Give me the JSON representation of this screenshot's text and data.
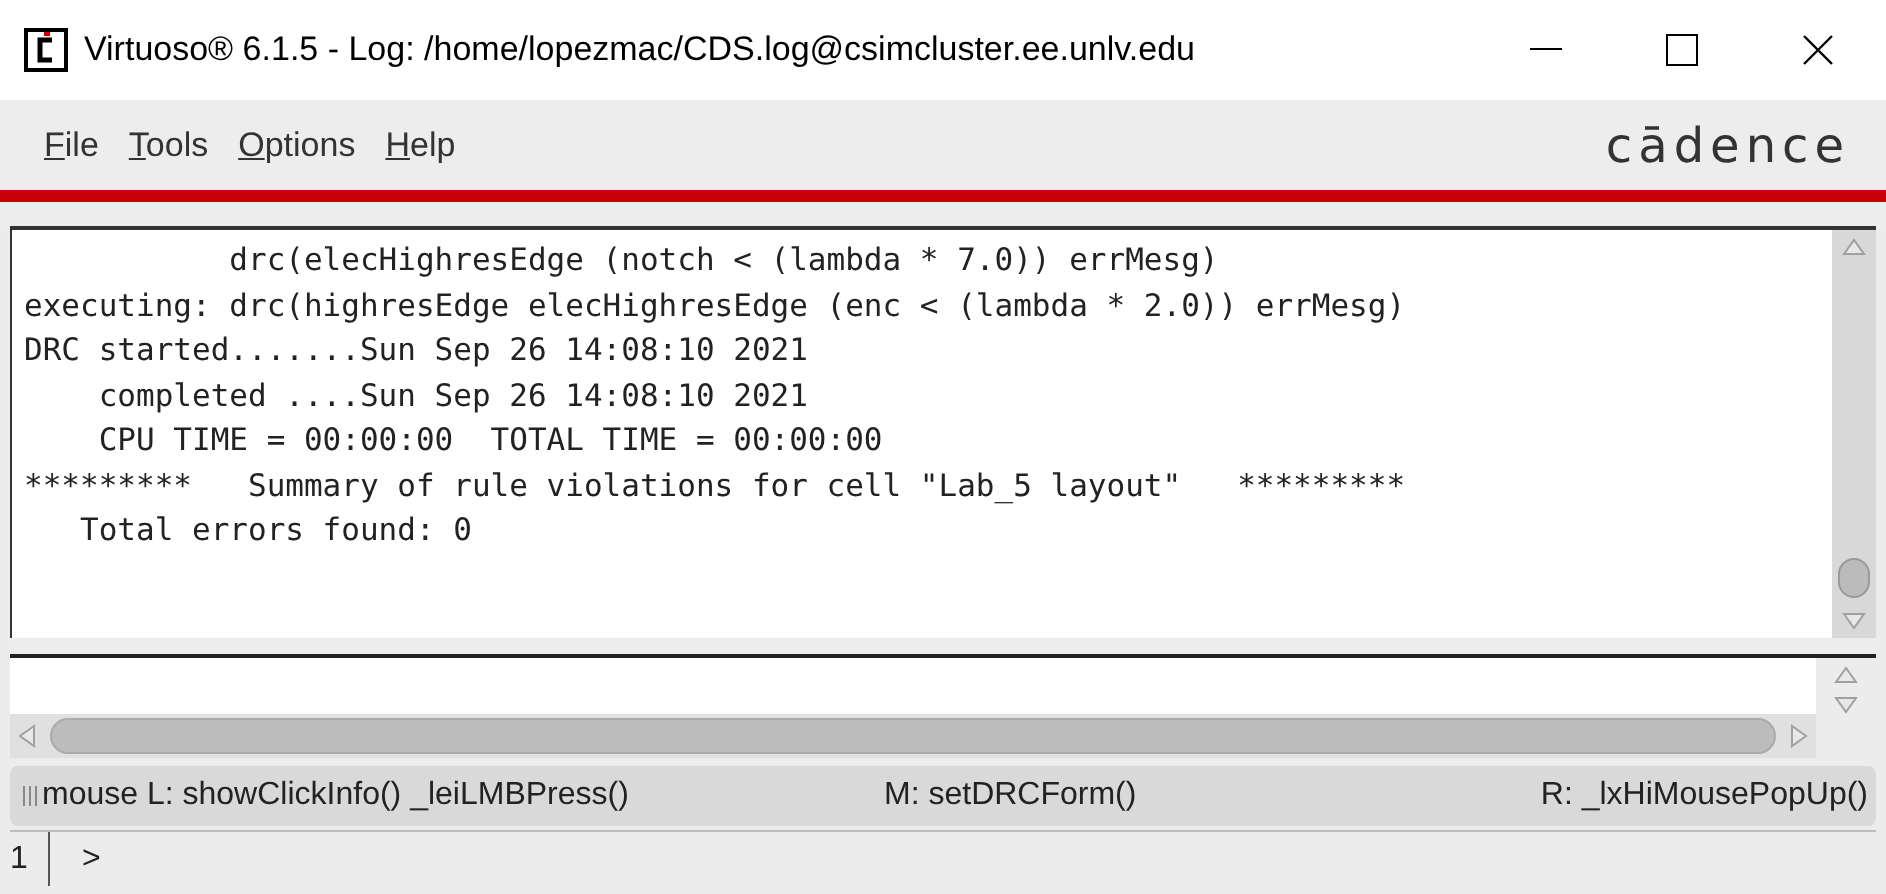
{
  "window": {
    "title": "Virtuoso® 6.1.5 - Log: /home/lopezmac/CDS.log@csimcluster.ee.unlv.edu"
  },
  "menu": [
    "File",
    "Tools",
    "Options",
    "Help"
  ],
  "brand": "cādence",
  "log_lines": [
    "           drc(elecHighresEdge (notch < (lambda * 7.0)) errMesg)",
    "executing: drc(highresEdge elecHighresEdge (enc < (lambda * 2.0)) errMesg)",
    "DRC started.......Sun Sep 26 14:08:10 2021",
    "    completed ....Sun Sep 26 14:08:10 2021",
    "    CPU TIME = 00:00:00  TOTAL TIME = 00:00:00",
    "*********   Summary of rule violations for cell \"Lab_5 layout\"   *********",
    "   Total errors found: 0"
  ],
  "status_bar": [
    "mouse L: showClickInfo() _leiLMBPress()",
    "M: setDRCForm()",
    "R: _lxHiMousePopUp()"
  ],
  "command_line": {
    "line_number": "1",
    "prompt": ">"
  }
}
